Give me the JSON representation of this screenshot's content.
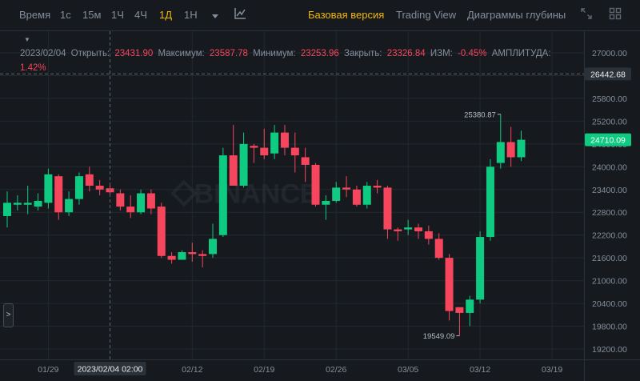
{
  "toolbar": {
    "time_label": "Время",
    "intervals": [
      {
        "label": "1с",
        "active": false
      },
      {
        "label": "15м",
        "active": false
      },
      {
        "label": "1Ч",
        "active": false
      },
      {
        "label": "4Ч",
        "active": false
      },
      {
        "label": "1Д",
        "active": true
      },
      {
        "label": "1Н",
        "active": false
      }
    ],
    "dropdown_icon": "caret-down-icon",
    "indicator_icon": "chart-line-icon",
    "views": [
      {
        "label": "Базовая версия",
        "active": true
      },
      {
        "label": "Trading View",
        "active": false
      },
      {
        "label": "Диаграммы глубины",
        "active": false
      }
    ],
    "expand_icon": "expand-icon",
    "grid_icon": "grid-layout-icon"
  },
  "ohlc": {
    "date": "2023/02/04",
    "open_label": "Открыть:",
    "open": "23431.90",
    "high_label": "Максимум:",
    "high": "23587.78",
    "low_label": "Минимум:",
    "low": "23253.96",
    "close_label": "Закрыть:",
    "close": "23326.84",
    "change_label": "ИЗМ:",
    "change": "-0.45%",
    "amplitude_label": "АМПЛИТУДА:",
    "amplitude": "1.42%"
  },
  "colors": {
    "background": "#161a1e",
    "up": "#0ecb81",
    "down": "#f6465d",
    "accent": "#f0b90b",
    "grid": "#232830",
    "text": "#848e9c"
  },
  "chart_data": {
    "type": "candlestick",
    "y_ticks": [
      "27000.00",
      "26400.00",
      "25800.00",
      "25200.00",
      "24600.00",
      "24000.00",
      "23400.00",
      "22800.00",
      "22200.00",
      "21600.00",
      "21000.00",
      "20400.00",
      "19800.00",
      "19200.00"
    ],
    "ylim": [
      18800,
      27400
    ],
    "x_ticks": [
      {
        "label": "01/29",
        "index": 4
      },
      {
        "label": "02/12",
        "index": 18
      },
      {
        "label": "02/19",
        "index": 25
      },
      {
        "label": "02/26",
        "index": 32
      },
      {
        "label": "03/05",
        "index": 39
      },
      {
        "label": "03/12",
        "index": 46
      },
      {
        "label": "03/19",
        "index": 53
      }
    ],
    "crosshair": {
      "index": 10,
      "time_label": "2023/02/04 02:00",
      "price_label": "26442.68",
      "price": 26442.68
    },
    "last_price": {
      "label": "24710.09",
      "value": 24710.09
    },
    "max_label": "25380.87",
    "max_index": 48,
    "min_label": "19549.09",
    "min_index": 44,
    "candles": [
      {
        "o": 22700,
        "h": 23350,
        "l": 22400,
        "c": 23050
      },
      {
        "o": 23000,
        "h": 23250,
        "l": 22850,
        "c": 23050
      },
      {
        "o": 23000,
        "h": 23500,
        "l": 22750,
        "c": 23050
      },
      {
        "o": 22950,
        "h": 23300,
        "l": 22850,
        "c": 23100
      },
      {
        "o": 23050,
        "h": 23950,
        "l": 22900,
        "c": 23800
      },
      {
        "o": 23750,
        "h": 23800,
        "l": 22600,
        "c": 22800
      },
      {
        "o": 22800,
        "h": 23350,
        "l": 22700,
        "c": 23150
      },
      {
        "o": 23150,
        "h": 23850,
        "l": 23000,
        "c": 23750
      },
      {
        "o": 23800,
        "h": 24000,
        "l": 23350,
        "c": 23500
      },
      {
        "o": 23500,
        "h": 23650,
        "l": 23250,
        "c": 23400
      },
      {
        "o": 23431.9,
        "h": 23587.78,
        "l": 23253.96,
        "c": 23326.84
      },
      {
        "o": 23300,
        "h": 23400,
        "l": 22850,
        "c": 22950
      },
      {
        "o": 22950,
        "h": 23250,
        "l": 22650,
        "c": 22800
      },
      {
        "o": 22800,
        "h": 23400,
        "l": 22750,
        "c": 23300
      },
      {
        "o": 23300,
        "h": 23400,
        "l": 22750,
        "c": 22900
      },
      {
        "o": 22950,
        "h": 23050,
        "l": 21600,
        "c": 21650
      },
      {
        "o": 21650,
        "h": 21750,
        "l": 21450,
        "c": 21550
      },
      {
        "o": 21550,
        "h": 21800,
        "l": 21550,
        "c": 21750
      },
      {
        "o": 21750,
        "h": 22000,
        "l": 21500,
        "c": 21700
      },
      {
        "o": 21700,
        "h": 21800,
        "l": 21350,
        "c": 21650
      },
      {
        "o": 21700,
        "h": 22500,
        "l": 21600,
        "c": 22100
      },
      {
        "o": 22200,
        "h": 24500,
        "l": 22150,
        "c": 24300
      },
      {
        "o": 24300,
        "h": 25100,
        "l": 23500,
        "c": 23500
      },
      {
        "o": 23500,
        "h": 24900,
        "l": 23450,
        "c": 24600
      },
      {
        "o": 24550,
        "h": 24600,
        "l": 24100,
        "c": 24500
      },
      {
        "o": 24500,
        "h": 25000,
        "l": 24200,
        "c": 24300
      },
      {
        "o": 24350,
        "h": 25100,
        "l": 24200,
        "c": 24900
      },
      {
        "o": 24900,
        "h": 25100,
        "l": 24300,
        "c": 24500
      },
      {
        "o": 24500,
        "h": 24900,
        "l": 23850,
        "c": 24300
      },
      {
        "o": 24250,
        "h": 24500,
        "l": 23600,
        "c": 24050
      },
      {
        "o": 24050,
        "h": 24100,
        "l": 22950,
        "c": 23000
      },
      {
        "o": 23000,
        "h": 23250,
        "l": 22600,
        "c": 23100
      },
      {
        "o": 23100,
        "h": 23600,
        "l": 23050,
        "c": 23450
      },
      {
        "o": 23450,
        "h": 23750,
        "l": 23200,
        "c": 23400
      },
      {
        "o": 23400,
        "h": 23500,
        "l": 22950,
        "c": 23000
      },
      {
        "o": 23000,
        "h": 23600,
        "l": 22900,
        "c": 23500
      },
      {
        "o": 23500,
        "h": 23650,
        "l": 23300,
        "c": 23450
      },
      {
        "o": 23450,
        "h": 23500,
        "l": 22100,
        "c": 22350
      },
      {
        "o": 22350,
        "h": 22400,
        "l": 22050,
        "c": 22300
      },
      {
        "o": 22350,
        "h": 22600,
        "l": 22200,
        "c": 22400
      },
      {
        "o": 22400,
        "h": 22500,
        "l": 22100,
        "c": 22300
      },
      {
        "o": 22300,
        "h": 22450,
        "l": 21950,
        "c": 22100
      },
      {
        "o": 22100,
        "h": 22250,
        "l": 21550,
        "c": 21600
      },
      {
        "o": 21600,
        "h": 21700,
        "l": 19950,
        "c": 20200
      },
      {
        "o": 20300,
        "h": 20300,
        "l": 19549.09,
        "c": 20150
      },
      {
        "o": 20150,
        "h": 20600,
        "l": 19800,
        "c": 20500
      },
      {
        "o": 20500,
        "h": 22300,
        "l": 20400,
        "c": 22150
      },
      {
        "o": 22150,
        "h": 24200,
        "l": 22050,
        "c": 24000
      },
      {
        "o": 24100,
        "h": 25380.87,
        "l": 23950,
        "c": 24650
      },
      {
        "o": 24650,
        "h": 25050,
        "l": 24000,
        "c": 24250
      },
      {
        "o": 24250,
        "h": 24950,
        "l": 24150,
        "c": 24710.09
      }
    ]
  },
  "side_handle": ">"
}
